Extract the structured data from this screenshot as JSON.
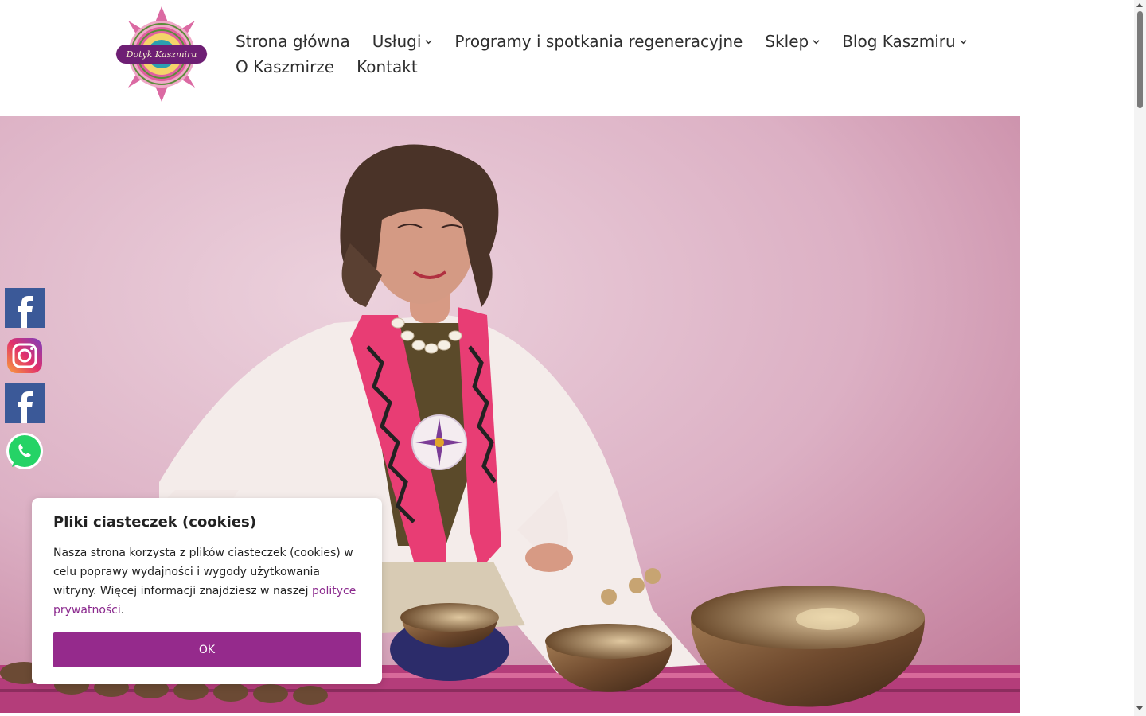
{
  "brand": {
    "logo_text": "Dotyk Kaszmiru"
  },
  "nav": {
    "items": [
      {
        "label": "Strona główna",
        "has_dropdown": false
      },
      {
        "label": "Usługi",
        "has_dropdown": true
      },
      {
        "label": "Programy i spotkania regeneracyjne",
        "has_dropdown": false
      },
      {
        "label": "Sklep",
        "has_dropdown": true
      },
      {
        "label": "Blog Kaszmiru",
        "has_dropdown": true
      },
      {
        "label": "O Kaszmirze",
        "has_dropdown": false
      },
      {
        "label": "Kontakt",
        "has_dropdown": false
      }
    ]
  },
  "social": [
    "facebook-icon",
    "instagram-icon",
    "facebook-icon",
    "whatsapp-icon"
  ],
  "cookie": {
    "title": "Pliki ciasteczek (cookies)",
    "text": "Nasza strona korzysta z plików ciasteczek (cookies) w celu poprawy wydajności i wygody użytkowania witryny. Więcej informacji znajdziesz w naszej ",
    "link": "polityce prywatności",
    "after_link": ".",
    "button": "OK"
  },
  "colors": {
    "accent": "#952a8c",
    "link": "#8b2a8e",
    "hero_bg": "#dcb0c4",
    "facebook": "#3b5998",
    "whatsapp": "#25d366"
  }
}
